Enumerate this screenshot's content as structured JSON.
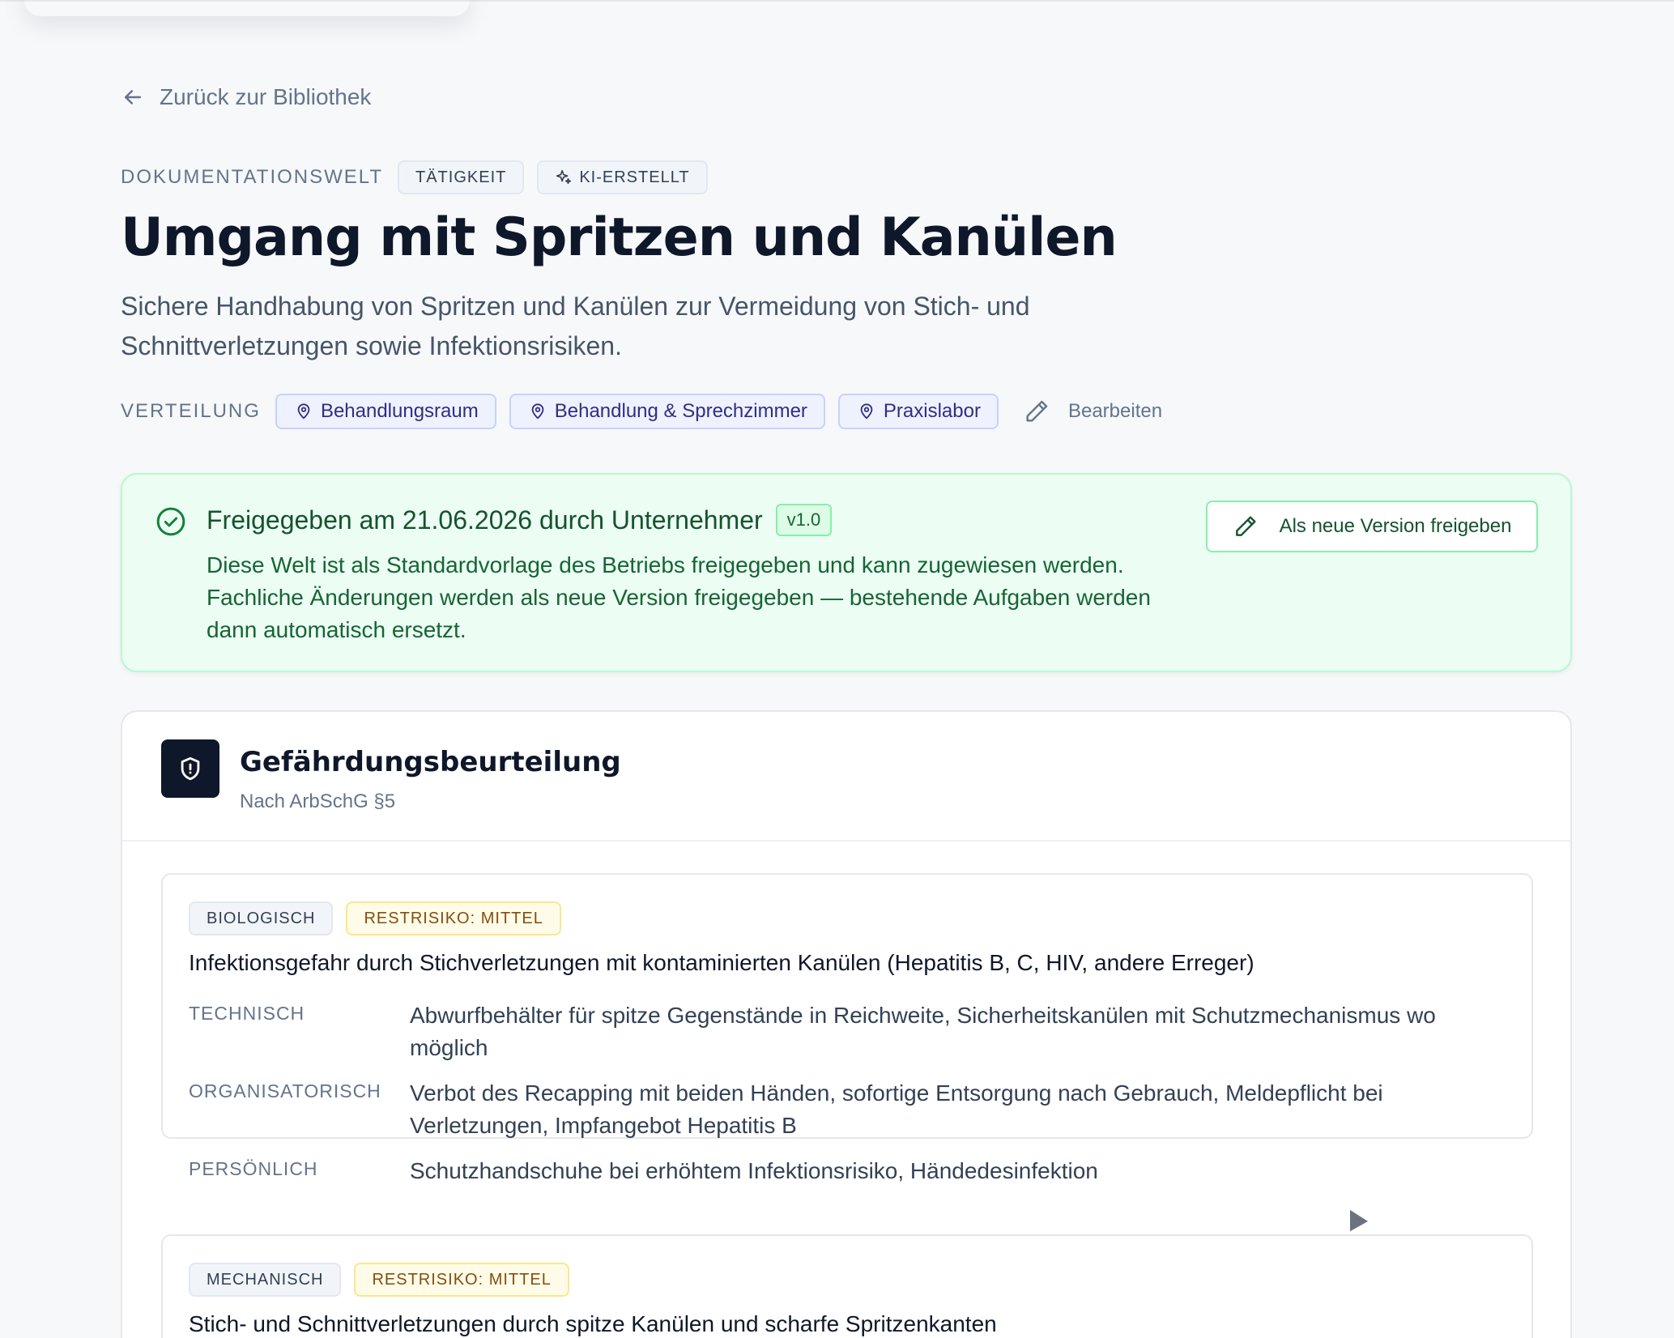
{
  "back_link": {
    "label": "Zurück zur Bibliothek"
  },
  "header": {
    "eyebrow": "DOKUMENTATIONSWELT",
    "tags": [
      "TÄTIGKEIT",
      "KI-ERSTELLT"
    ],
    "title": "Umgang mit Spritzen und Kanülen",
    "subtitle": "Sichere Handhabung von Spritzen und Kanülen zur Vermeidung von Stich- und Schnittverletzungen sowie Infektionsrisiken."
  },
  "distribution": {
    "label": "VERTEILUNG",
    "locations": [
      "Behandlungsraum",
      "Behandlung & Sprechzimmer",
      "Praxislabor"
    ],
    "edit_label": "Bearbeiten"
  },
  "approval": {
    "heading": "Freigegeben am 21.06.2026 durch Unternehmer",
    "version": "v1.0",
    "description": "Diese Welt ist als Standardvorlage des Betriebs freigegeben und kann zugewiesen werden. Fachliche Änderungen werden als neue Version freigegeben — bestehende Aufgaben werden dann automatisch ersetzt.",
    "button_label": "Als neue Version freigeben",
    "colors": {
      "background": "#ecfdf3",
      "border": "#bbf7d0",
      "text": "#14532d"
    }
  },
  "risk_assessment": {
    "icon": "shield-alert-icon",
    "title": "Gefährdungsbeurteilung",
    "subtitle": "Nach ArbSchG §5",
    "hazards": [
      {
        "category": "BIOLOGISCH",
        "residual_risk": "RESTRISIKO: MITTEL",
        "title": "Infektionsgefahr durch Stichverletzungen mit kontaminierten Kanülen (Hepatitis B, C, HIV, andere Erreger)",
        "measures": [
          {
            "label": "TECHNISCH",
            "text": "Abwurfbehälter für spitze Gegenstände in Reichweite, Sicherheitskanülen mit Schutzmechanismus wo möglich"
          },
          {
            "label": "ORGANISATORISCH",
            "text": "Verbot des Recapping mit beiden Händen, sofortige Entsorgung nach Gebrauch, Meldepflicht bei Verletzungen, Impfangebot Hepatitis B"
          },
          {
            "label": "PERSÖNLICH",
            "text": "Schutzhandschuhe bei erhöhtem Infektionsrisiko, Händedesinfektion"
          }
        ]
      },
      {
        "category": "MECHANISCH",
        "residual_risk": "RESTRISIKO: MITTEL",
        "title": "Stich- und Schnittverletzungen durch spitze Kanülen und scharfe Spritzenkanten"
      }
    ]
  }
}
